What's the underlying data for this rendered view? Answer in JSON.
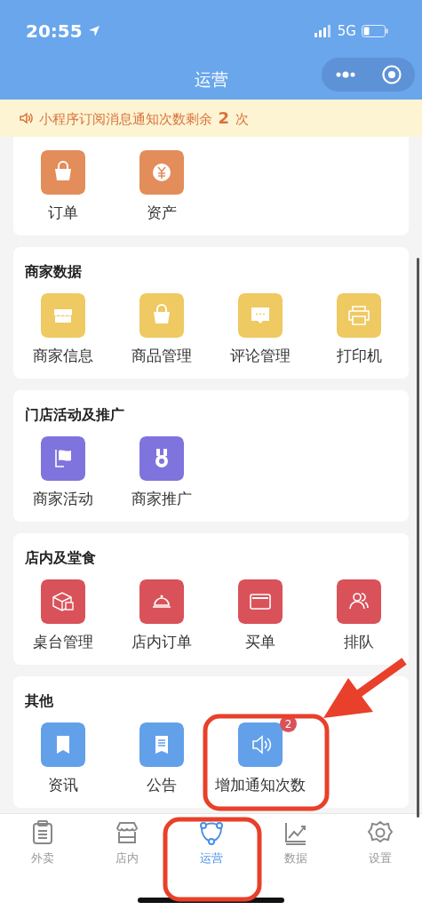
{
  "status_bar": {
    "time": "20:55",
    "network": "5G"
  },
  "nav": {
    "title": "运营"
  },
  "notice": {
    "text": "小程序订阅消息通知次数剩余 **2** 次"
  },
  "sections": [
    {
      "color": "#e38d5b",
      "items": [
        {
          "label": "订单"
        },
        {
          "label": "资产"
        }
      ]
    },
    {
      "title": "商家数据",
      "color": "#efc962",
      "items": [
        {
          "label": "商家信息"
        },
        {
          "label": "商品管理"
        },
        {
          "label": "评论管理"
        },
        {
          "label": "打印机"
        }
      ]
    },
    {
      "title": "门店活动及推广",
      "color": "#7f74dd",
      "items": [
        {
          "label": "商家活动"
        },
        {
          "label": "商家推广"
        }
      ]
    },
    {
      "title": "店内及堂食",
      "color": "#d9525a",
      "items": [
        {
          "label": "桌台管理"
        },
        {
          "label": "店内订单"
        },
        {
          "label": "买单"
        },
        {
          "label": "排队"
        }
      ]
    },
    {
      "title": "其他",
      "color": "#62a0ea",
      "items": [
        {
          "label": "资讯"
        },
        {
          "label": "公告"
        },
        {
          "label": "增加通知次数",
          "badge": "2"
        }
      ]
    }
  ],
  "tabs": [
    {
      "label": "外卖",
      "selected": false
    },
    {
      "label": "店内",
      "selected": false
    },
    {
      "label": "运营",
      "selected": true
    },
    {
      "label": "数据",
      "selected": false
    },
    {
      "label": "设置",
      "selected": false
    }
  ]
}
